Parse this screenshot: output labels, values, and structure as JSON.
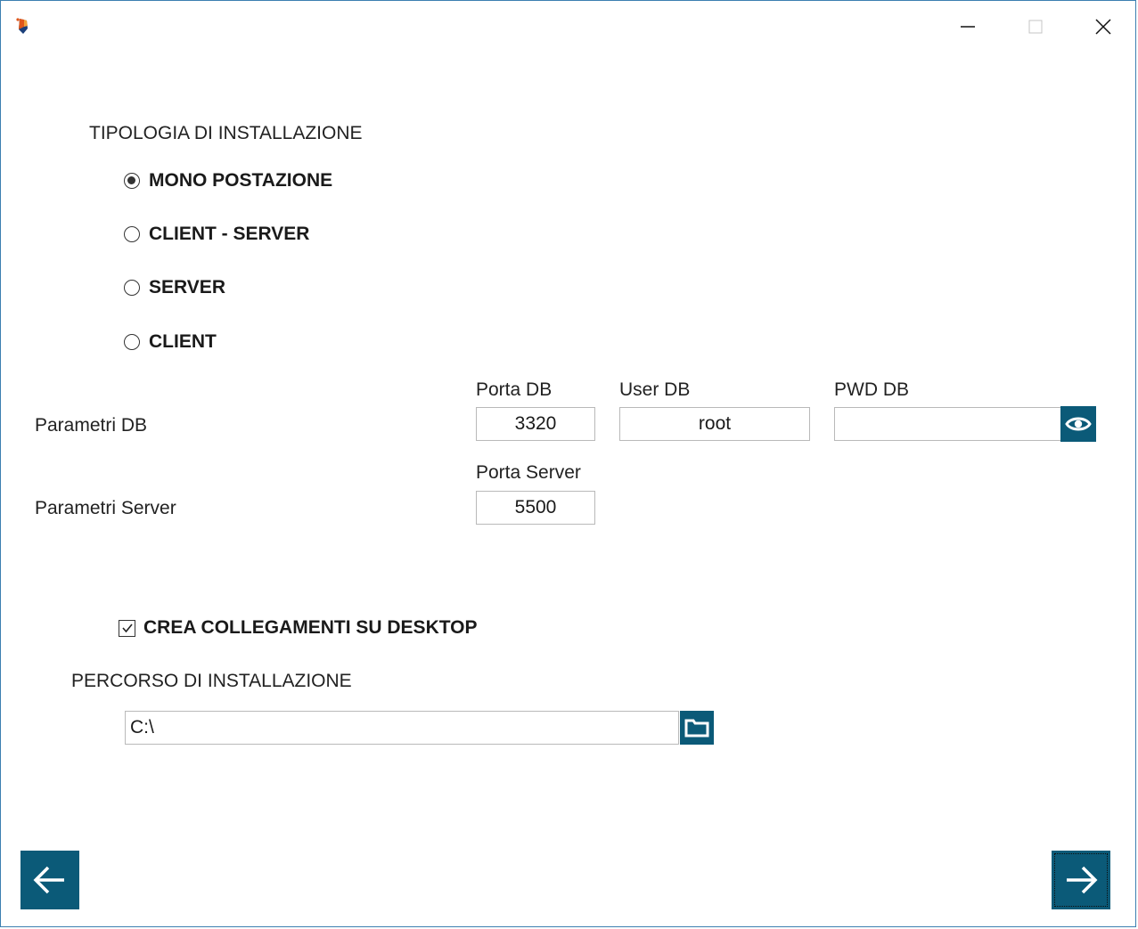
{
  "window": {
    "icon": "app-installer-icon",
    "controls": {
      "minimize_icon": "minimize-icon",
      "maximize_icon": "maximize-icon",
      "close_icon": "close-icon"
    }
  },
  "install_type": {
    "title": "TIPOLOGIA DI INSTALLAZIONE",
    "options": [
      {
        "label": "MONO POSTAZIONE",
        "selected": true
      },
      {
        "label": "CLIENT - SERVER",
        "selected": false
      },
      {
        "label": "SERVER",
        "selected": false
      },
      {
        "label": "CLIENT",
        "selected": false
      }
    ]
  },
  "db_params": {
    "row_label": "Parametri DB",
    "port_label": "Porta DB",
    "port_value": "3320",
    "user_label": "User DB",
    "user_value": "root",
    "pwd_label": "PWD DB",
    "pwd_value": "",
    "show_password_icon": "eye-icon"
  },
  "server_params": {
    "row_label": "Parametri Server",
    "port_label": "Porta Server",
    "port_value": "5500"
  },
  "shortcuts": {
    "label": "CREA COLLEGAMENTI SU DESKTOP",
    "checked": true
  },
  "install_path": {
    "title": "PERCORSO DI INSTALLAZIONE",
    "value": "C:\\",
    "browse_icon": "folder-icon"
  },
  "navigation": {
    "back_icon": "arrow-left-icon",
    "next_icon": "arrow-right-icon"
  },
  "colors": {
    "accent": "#0b5a78",
    "window_border": "#3c7fb1",
    "field_border": "#b9b9b9"
  }
}
